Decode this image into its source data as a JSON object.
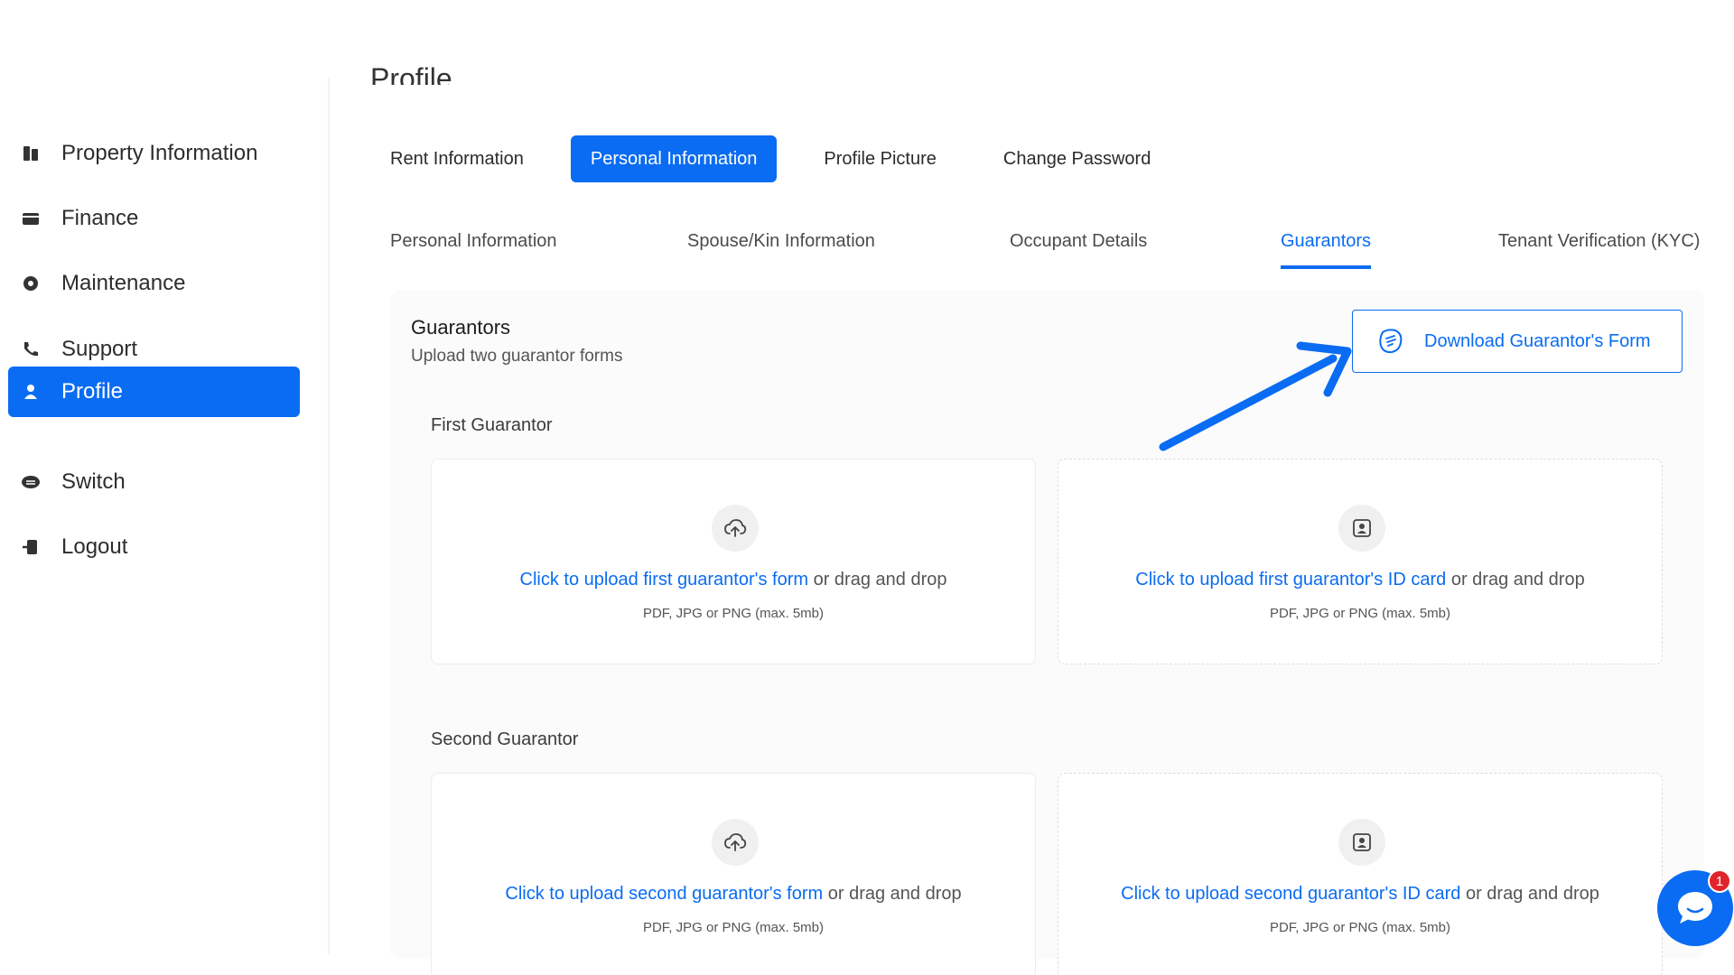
{
  "page": {
    "title": "Profile"
  },
  "sidebar": {
    "items": [
      {
        "label": "Property Information",
        "icon": "building-icon"
      },
      {
        "label": "Finance",
        "icon": "wallet-icon"
      },
      {
        "label": "Maintenance",
        "icon": "gear-icon"
      },
      {
        "label": "Support",
        "icon": "phone-icon"
      },
      {
        "label": "Profile",
        "icon": "user-icon",
        "active": true
      },
      {
        "label": "Switch",
        "icon": "switch-icon"
      },
      {
        "label": "Logout",
        "icon": "logout-icon"
      }
    ]
  },
  "tabs_primary": [
    {
      "label": "Rent Information"
    },
    {
      "label": "Personal Information",
      "active": true
    },
    {
      "label": "Profile Picture"
    },
    {
      "label": "Change Password"
    }
  ],
  "tabs_secondary": [
    {
      "label": "Personal Information"
    },
    {
      "label": "Spouse/Kin Information"
    },
    {
      "label": "Occupant Details"
    },
    {
      "label": "Guarantors",
      "active": true
    },
    {
      "label": "Tenant Verification (KYC)"
    }
  ],
  "guarantors": {
    "title": "Guarantors",
    "subtitle": "Upload two guarantor forms",
    "download_label": "Download Guarantor's Form",
    "first_label": "First Guarantor",
    "second_label": "Second Guarantor",
    "uploads": {
      "first_form": {
        "link": "Click to upload first guarantor's form",
        "rest": " or drag and drop",
        "hint": "PDF, JPG or PNG (max. 5mb)"
      },
      "first_id": {
        "link": "Click to upload first guarantor's ID card",
        "rest": " or drag and drop",
        "hint": "PDF, JPG or PNG (max. 5mb)"
      },
      "second_form": {
        "link": "Click to upload second guarantor's form",
        "rest": " or drag and drop",
        "hint": "PDF, JPG or PNG (max. 5mb)"
      },
      "second_id": {
        "link": "Click to upload second guarantor's ID card",
        "rest": " or drag and drop",
        "hint": "PDF, JPG or PNG (max. 5mb)"
      }
    }
  },
  "chat": {
    "badge_count": "1"
  },
  "colors": {
    "accent": "#0a6cf2",
    "badge": "#e0242b"
  }
}
